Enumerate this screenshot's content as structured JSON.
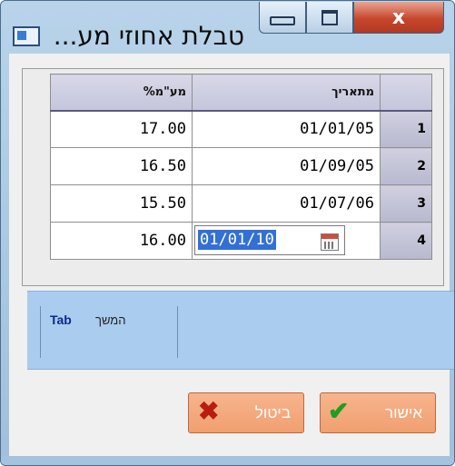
{
  "window": {
    "title": "טבלת אחוזי מע...",
    "buttons": {
      "minimize_icon": "minimize-icon",
      "maximize_icon": "maximize-icon",
      "close_label": "x"
    }
  },
  "grid": {
    "columns": [
      "%מע\"מ",
      "מתאריך",
      ""
    ],
    "rows": [
      {
        "vat": "17.00",
        "date": "01/01/05",
        "num": "1"
      },
      {
        "vat": "16.50",
        "date": "01/09/05",
        "num": "2"
      },
      {
        "vat": "15.50",
        "date": "01/07/06",
        "num": "3"
      },
      {
        "vat": "16.00",
        "date": "01/01/10",
        "num": "4"
      }
    ],
    "editing_row": 4
  },
  "hint": {
    "key": "Tab",
    "action": "המשך"
  },
  "buttons": {
    "cancel": "ביטול",
    "ok": "אישור"
  },
  "colors": {
    "accent": "#3370d6",
    "panel": "#a9ccef",
    "button": "#f0a070",
    "close": "#c7462c"
  }
}
